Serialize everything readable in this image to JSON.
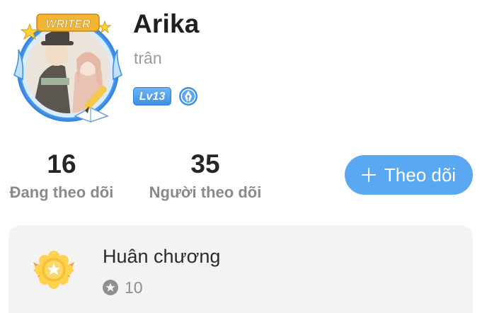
{
  "profile": {
    "avatar_frame_label": "WRITER",
    "name": "Arika",
    "subname": "trân",
    "level_badge": "Lv13",
    "writer_icon": "pen-nib-icon"
  },
  "stats": {
    "following": {
      "value": "16",
      "label": "Đang theo dõi"
    },
    "followers": {
      "value": "35",
      "label": "Người theo dõi"
    }
  },
  "follow_button": {
    "label": "Theo dõi",
    "icon": "plus-icon"
  },
  "medals": {
    "title": "Huân chương",
    "count": "10",
    "icon": "medal-icon",
    "count_icon": "star-circle-icon"
  },
  "colors": {
    "accent": "#5aa8f2",
    "level_badge": "#3d8fe6",
    "card_bg": "#f3f3f3",
    "muted_text": "#8a8a8a",
    "frame_gold": "#f2b632"
  }
}
